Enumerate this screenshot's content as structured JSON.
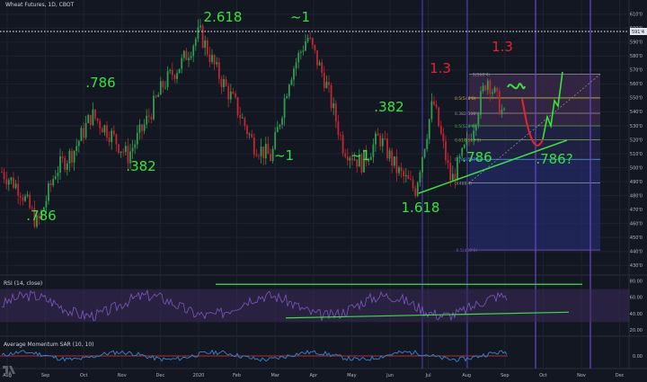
{
  "title": "Wheat Futures, 1D, CBOT",
  "price_tag": "591'4",
  "rsi_label": "RSI (14, close)",
  "ams_label": "Average Momentum SAR (10, 10)",
  "colors": {
    "background": "#131722",
    "up": "#26a69a",
    "up_candle": "#2e9e4f",
    "down_candle": "#c2262f",
    "annotation_green": "#36e33a",
    "annotation_red": "#e8232e",
    "fib_box": "#2b2a5c",
    "rsi_band": "#3a2a5a",
    "rsi_line": "#7e57c2",
    "ams_line": "#2a8ad6"
  },
  "chart_data": [
    {
      "type": "candlestick",
      "title": "Wheat Futures, 1D, CBOT",
      "x_axis_labels": [
        "Aug",
        "Sep",
        "Oct",
        "Nov",
        "Dec",
        "2020",
        "Feb",
        "Mar",
        "Apr",
        "May",
        "Jun",
        "Jul",
        "Aug",
        "Sep",
        "Oct",
        "Nov",
        "Dec"
      ],
      "y_axis_labels": [
        "610'0",
        "600'0",
        "590'0",
        "580'0",
        "570'0",
        "560'0",
        "550'0",
        "540'0",
        "530'0",
        "520'0",
        "510'0",
        "500'0",
        "490'0",
        "480'0",
        "470'0",
        "460'0",
        "450'0",
        "440'0",
        "430'0"
      ],
      "ylim": [
        425,
        615
      ],
      "price_series": [
        {
          "x": "Aug",
          "price": 497
        },
        {
          "x": "Aug",
          "price": 485
        },
        {
          "x": "Sep",
          "price": 459
        },
        {
          "x": "Sep",
          "price": 498
        },
        {
          "x": "Oct",
          "price": 512
        },
        {
          "x": "Oct",
          "price": 538
        },
        {
          "x": "Nov",
          "price": 525
        },
        {
          "x": "Nov",
          "price": 508
        },
        {
          "x": "Dec",
          "price": 532
        },
        {
          "x": "Dec",
          "price": 560
        },
        {
          "x": "2020",
          "price": 575
        },
        {
          "x": "2020",
          "price": 597
        },
        {
          "x": "Feb",
          "price": 568
        },
        {
          "x": "Feb",
          "price": 545
        },
        {
          "x": "Mar",
          "price": 517
        },
        {
          "x": "Mar",
          "price": 507
        },
        {
          "x": "Mar",
          "price": 565
        },
        {
          "x": "Apr",
          "price": 594
        },
        {
          "x": "Apr",
          "price": 562
        },
        {
          "x": "May",
          "price": 515
        },
        {
          "x": "May",
          "price": 503
        },
        {
          "x": "Jun",
          "price": 522
        },
        {
          "x": "Jun",
          "price": 498
        },
        {
          "x": "Jul",
          "price": 484
        },
        {
          "x": "Jul",
          "price": 548
        },
        {
          "x": "Aug",
          "price": 490
        },
        {
          "x": "Aug",
          "price": 520
        },
        {
          "x": "Sep",
          "price": 565
        },
        {
          "x": "Sep",
          "price": 535
        }
      ],
      "fib_levels": [
        {
          "label": "1(566'4)",
          "price": 567
        },
        {
          "label": "0.5(548'6)",
          "price": 550
        },
        {
          "label": "0.382(538'4)",
          "price": 539
        },
        {
          "label": "0.5(528'4)",
          "price": 530
        },
        {
          "label": "0.618(519'0)",
          "price": 520
        },
        {
          "label": "0.786(507'6)",
          "price": 506
        },
        {
          "label": "0(488'4)",
          "price": 489
        },
        {
          "label": "-0.5(440'0)",
          "price": 441
        }
      ],
      "annotations": [
        {
          "text": ".786",
          "color": "green"
        },
        {
          "text": ".786",
          "color": "green"
        },
        {
          "text": ".382",
          "color": "green"
        },
        {
          "text": "2.618",
          "color": "green"
        },
        {
          "text": "~1",
          "color": "green"
        },
        {
          "text": "~1",
          "color": "green"
        },
        {
          "text": "~1",
          "color": "green"
        },
        {
          "text": ".382",
          "color": "green"
        },
        {
          "text": "1.3",
          "color": "red"
        },
        {
          "text": "1.3",
          "color": "red"
        },
        {
          "text": "1.618",
          "color": "green"
        },
        {
          "text": ".786",
          "color": "green"
        },
        {
          "text": ".786?",
          "color": "green"
        }
      ]
    },
    {
      "type": "line",
      "title": "RSI (14, close)",
      "y_axis_labels": [
        "80.00",
        "60.00",
        "40.00",
        "20.00"
      ],
      "ylim": [
        15,
        85
      ],
      "band": [
        30,
        70
      ]
    },
    {
      "type": "line",
      "title": "Average Momentum SAR (10, 10)",
      "y_axis_labels": [
        "0.00"
      ]
    }
  ]
}
